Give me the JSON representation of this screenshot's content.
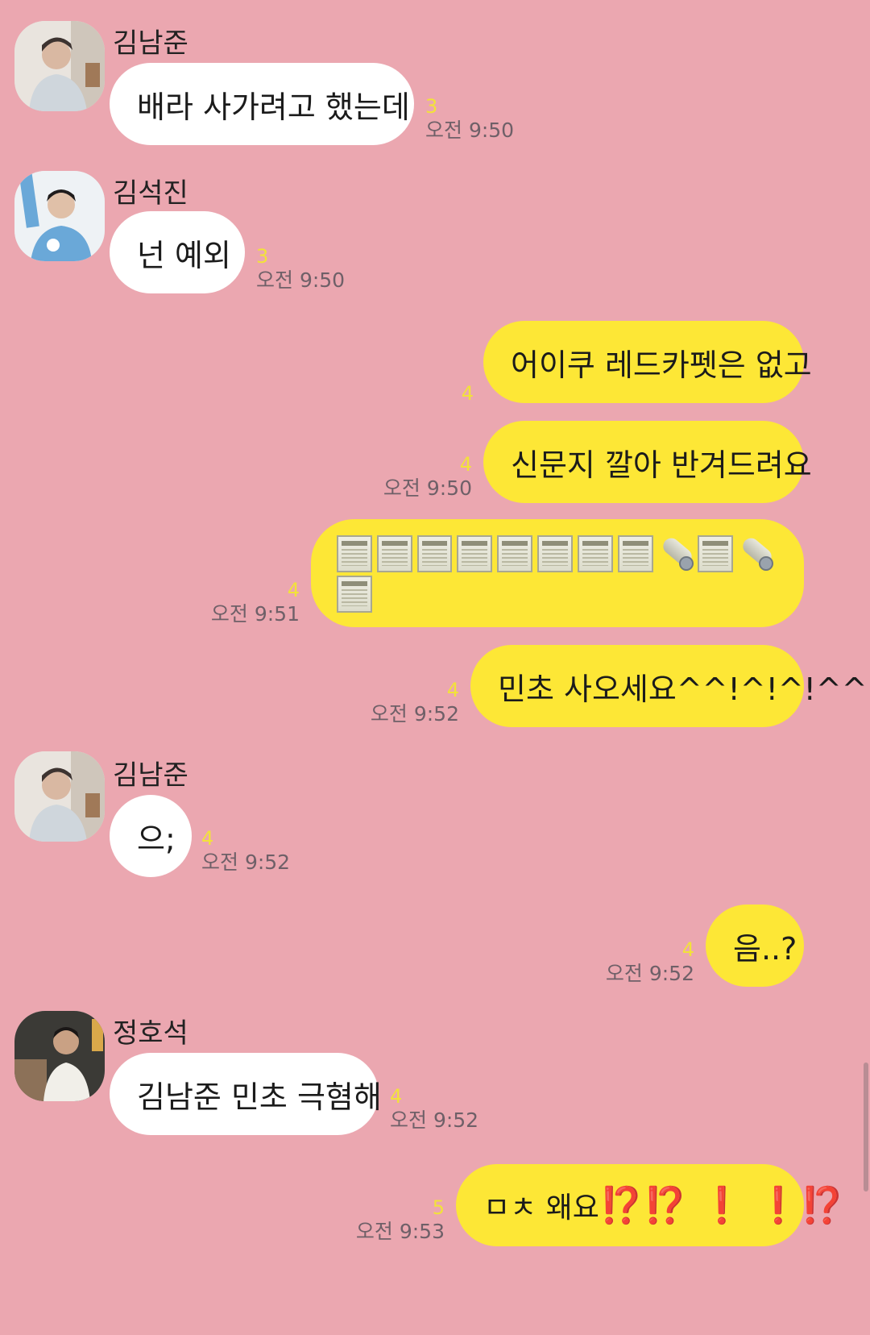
{
  "messages": [
    {
      "sender": "김남준",
      "text": "배라 사가려고 했는데",
      "unread": "3",
      "time": "오전 9:50"
    },
    {
      "sender": "김석진",
      "text": "넌 예외",
      "unread": "3",
      "time": "오전 9:50"
    },
    {
      "text": "어이쿠 레드카펫은 없고",
      "unread": "4"
    },
    {
      "text": "신문지 깔아 반겨드려요",
      "unread": "4",
      "time": "오전 9:50"
    },
    {
      "emoji": [
        "newspaper",
        "newspaper",
        "newspaper",
        "newspaper",
        "newspaper",
        "newspaper",
        "newspaper",
        "newspaper",
        "rolled-up-newspaper",
        "newspaper",
        "rolled-up-newspaper",
        "newspaper"
      ],
      "unread": "4",
      "time": "오전 9:51"
    },
    {
      "text": "민초 사오세요^^!^!^!^^!!",
      "unread": "4",
      "time": "오전 9:52"
    },
    {
      "sender": "김남준",
      "text": "으;",
      "unread": "4",
      "time": "오전 9:52"
    },
    {
      "text": "음..?",
      "unread": "4",
      "time": "오전 9:52"
    },
    {
      "sender": "정호석",
      "text": "김남준 민초 극혐해",
      "unread": "4",
      "time": "오전 9:52"
    },
    {
      "text_prefix": "ㅁㅊ 왜요",
      "text_emphasis": "⁉️⁉️ ❗️ ❗️⁉️",
      "unread": "5",
      "time": "오전 9:53"
    }
  ],
  "colors": {
    "background": "#eba7b0",
    "incoming_bubble": "#ffffff",
    "outgoing_bubble": "#fde736",
    "unread_count": "#f2e23a",
    "emphasis": "#e3262d"
  }
}
